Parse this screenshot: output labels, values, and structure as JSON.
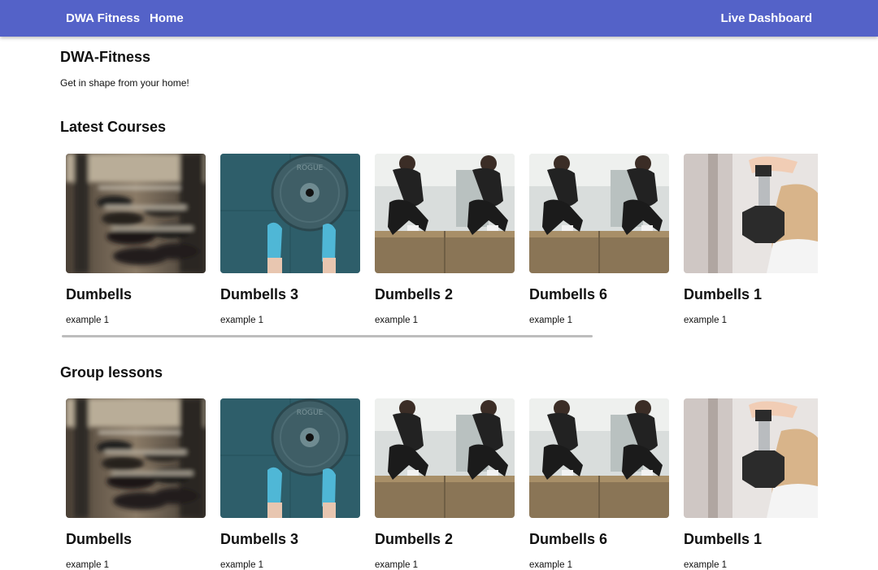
{
  "nav": {
    "brand": "DWA Fitness",
    "home": "Home",
    "dashboard": "Live Dashboard"
  },
  "page": {
    "title": "DWA-Fitness",
    "subtitle": "Get in shape from your home!"
  },
  "colors": {
    "navbar": "#5462c8",
    "nav_text": "#ffffff",
    "scrollbar": "#bdbdbd"
  },
  "sections": [
    {
      "title": "Latest Courses",
      "cards": [
        {
          "title": "Dumbells",
          "description": "example 1",
          "image": "blurred-dumbbell-rack-photo"
        },
        {
          "title": "Dumbells 3",
          "description": "example 1",
          "image": "weight-plate-and-sneakers-photo"
        },
        {
          "title": "Dumbells 2",
          "description": "example 1",
          "image": "box-jump-squat-photo"
        },
        {
          "title": "Dumbells 6",
          "description": "example 1",
          "image": "box-jump-squat-photo"
        },
        {
          "title": "Dumbells 1",
          "description": "example 1",
          "image": "woman-lifting-hex-dumbbell-photo"
        }
      ]
    },
    {
      "title": "Group lessons",
      "cards": [
        {
          "title": "Dumbells",
          "description": "example 1",
          "image": "blurred-dumbbell-rack-photo"
        },
        {
          "title": "Dumbells 3",
          "description": "example 1",
          "image": "weight-plate-and-sneakers-photo"
        },
        {
          "title": "Dumbells 2",
          "description": "example 1",
          "image": "box-jump-squat-photo"
        },
        {
          "title": "Dumbells 6",
          "description": "example 1",
          "image": "box-jump-squat-photo"
        },
        {
          "title": "Dumbells 1",
          "description": "example 1",
          "image": "woman-lifting-hex-dumbbell-photo"
        }
      ]
    }
  ]
}
